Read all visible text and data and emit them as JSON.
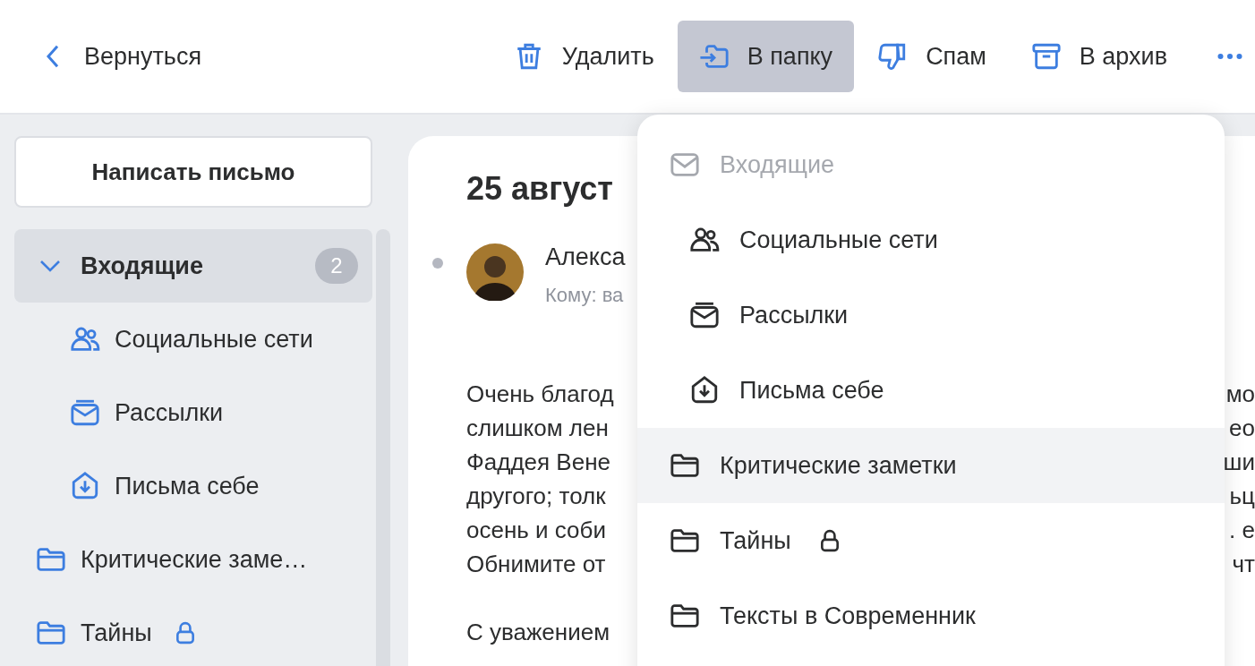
{
  "toolbar": {
    "back": {
      "label": "Вернуться"
    },
    "actions": [
      {
        "kind": "trash",
        "label": "Удалить",
        "selected": false
      },
      {
        "kind": "move",
        "label": "В папку",
        "selected": true
      },
      {
        "kind": "dislike",
        "label": "Спам",
        "selected": false
      },
      {
        "kind": "archive",
        "label": "В архив",
        "selected": false
      }
    ]
  },
  "sidebar": {
    "compose_button": "Написать письмо",
    "folders": [
      {
        "label": "Входящие",
        "selected": true,
        "expanded": true,
        "count": "2",
        "locked": false,
        "children": [
          {
            "kind": "people",
            "label": "Социальные сети",
            "selected": false,
            "locked": false
          },
          {
            "kind": "newsletter",
            "label": "Рассылки",
            "selected": false,
            "locked": false
          },
          {
            "kind": "self",
            "label": "Письма себе",
            "selected": false,
            "locked": false
          }
        ]
      },
      {
        "kind": "folder",
        "label": "Критические заме…",
        "selected": false,
        "locked": false
      },
      {
        "kind": "folder",
        "label": "Тайны",
        "selected": false,
        "locked": true
      }
    ]
  },
  "message": {
    "date": "25 август",
    "sender": "Алекса",
    "recipient": "Кому: ва",
    "unread": true,
    "body_lines": [
      {
        "start": "Очень благод",
        "end": "мо"
      },
      {
        "start": "слишком лен",
        "end": "ео"
      },
      {
        "start": "Фаддея Вене",
        "end": "ши"
      },
      {
        "start": "другого; толк",
        "end": "ьц"
      },
      {
        "start": "осень и соби",
        "end": ". е"
      },
      {
        "start": "Обнимите от",
        "end": "чт"
      },
      {
        "start": "С уважением"
      }
    ]
  },
  "folder_menu": {
    "items": [
      {
        "kind": "inbox",
        "label": "Входящие",
        "disabled": true,
        "highlighted": false,
        "locked": false,
        "children": [
          {
            "kind": "people",
            "label": "Социальные сети",
            "disabled": false,
            "highlighted": false,
            "locked": false
          },
          {
            "kind": "newsletter",
            "label": "Рассылки",
            "disabled": false,
            "highlighted": false,
            "locked": false
          },
          {
            "kind": "self",
            "label": "Письма себе",
            "disabled": false,
            "highlighted": false,
            "locked": false
          }
        ]
      },
      {
        "kind": "folder",
        "label": "Критические заметки",
        "disabled": false,
        "highlighted": true,
        "locked": false
      },
      {
        "kind": "folder",
        "label": "Тайны",
        "disabled": false,
        "highlighted": false,
        "locked": true
      },
      {
        "kind": "folder",
        "label": "Тексты в Современник",
        "disabled": false,
        "highlighted": false,
        "locked": false
      }
    ]
  }
}
